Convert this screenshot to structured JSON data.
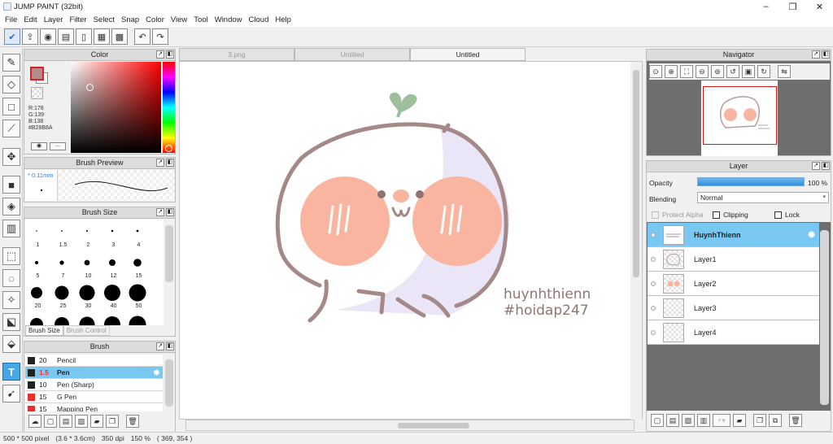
{
  "window": {
    "title": "JUMP PAINT (32bit)"
  },
  "menu": [
    "File",
    "Edit",
    "Layer",
    "Filter",
    "Select",
    "Snap",
    "Color",
    "View",
    "Tool",
    "Window",
    "Cloud",
    "Help"
  ],
  "color_panel": {
    "title": "Color",
    "r": "R:178",
    "g": "G:139",
    "b": "B:138",
    "hex": "#B28B8A",
    "fg_color": "#b28b8a",
    "btn2": "..."
  },
  "brush_preview": {
    "title": "Brush Preview",
    "size_text": "0.11mm"
  },
  "brush_size": {
    "title": "Brush Size",
    "tab_active": "Brush Size",
    "tab_inactive": "Brush Control",
    "rows": [
      [
        "1",
        "1.5",
        "2",
        "3",
        "4"
      ],
      [
        "5",
        "7",
        "10",
        "12",
        "15"
      ],
      [
        "20",
        "25",
        "30",
        "40",
        "50"
      ]
    ]
  },
  "brush": {
    "title": "Brush",
    "items": [
      {
        "size": "20",
        "name": "Pencil",
        "color": "#222222"
      },
      {
        "size": "1.5",
        "name": "Pen",
        "color": "#222222"
      },
      {
        "size": "10",
        "name": "Pen (Sharp)",
        "color": "#222222"
      },
      {
        "size": "15",
        "name": "G Pen",
        "color": "#e83030"
      },
      {
        "size": "15",
        "name": "Mapping Pen",
        "color": "#e83030"
      }
    ]
  },
  "doc_tabs": [
    {
      "label": "3.png"
    },
    {
      "label": "Untitled"
    },
    {
      "label": "Untitled"
    }
  ],
  "artwork": {
    "text1": "huynhthienn",
    "text2": "#hoidap247"
  },
  "navigator": {
    "title": "Navigator"
  },
  "layer_panel": {
    "title": "Layer",
    "opacity_label": "Opacity",
    "opacity_value": "100 %",
    "opacity_pct": 100,
    "blending_label": "Blending",
    "blending_value": "Normal",
    "protect_alpha": "Protect Alpha",
    "clipping": "Clipping",
    "lock": "Lock",
    "layers": [
      {
        "name": "HuynhThienn"
      },
      {
        "name": "Layer1"
      },
      {
        "name": "Layer2"
      },
      {
        "name": "Layer3"
      },
      {
        "name": "Layer4"
      }
    ]
  },
  "status": {
    "size": "500 * 500 pixel",
    "cm": "(3.6 * 3.6cm)",
    "dpi": "350 dpi",
    "zoom": "150 %",
    "coords": "( 369, 354 )"
  }
}
